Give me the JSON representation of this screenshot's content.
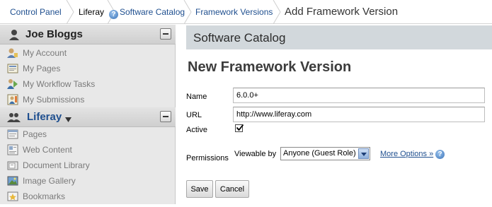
{
  "breadcrumb": {
    "items": [
      "Control Panel",
      "Liferay",
      "Software Catalog",
      "Framework Versions",
      "Add Framework Version"
    ]
  },
  "sidebar": {
    "user_section": {
      "title": "Joe Bloggs",
      "icon": "user-icon",
      "items": [
        {
          "label": "My Account",
          "icon": "account-icon"
        },
        {
          "label": "My Pages",
          "icon": "pages-icon"
        },
        {
          "label": "My Workflow Tasks",
          "icon": "workflow-icon"
        },
        {
          "label": "My Submissions",
          "icon": "submissions-icon"
        }
      ]
    },
    "site_section": {
      "title": "Liferay",
      "icon": "group-icon",
      "items": [
        {
          "label": "Pages",
          "icon": "page-icon"
        },
        {
          "label": "Web Content",
          "icon": "web-content-icon"
        },
        {
          "label": "Document Library",
          "icon": "document-library-icon"
        },
        {
          "label": "Image Gallery",
          "icon": "image-gallery-icon"
        },
        {
          "label": "Bookmarks",
          "icon": "bookmarks-icon"
        }
      ]
    }
  },
  "main": {
    "section_title": "Software Catalog",
    "form_title": "New Framework Version",
    "fields": {
      "name_label": "Name",
      "name_value": "6.0.0+",
      "url_label": "URL",
      "url_value": "http://www.liferay.com",
      "active_label": "Active",
      "active_checked": true,
      "permissions_label": "Permissions",
      "viewable_by_label": "Viewable by",
      "viewable_by_value": "Anyone (Guest Role)",
      "more_options": "More Options »"
    },
    "buttons": {
      "save": "Save",
      "cancel": "Cancel"
    }
  },
  "colors": {
    "link": "#1f4f8f",
    "section_bar": "#d2d8dc",
    "sidebar_bg": "#e8e8e8"
  }
}
